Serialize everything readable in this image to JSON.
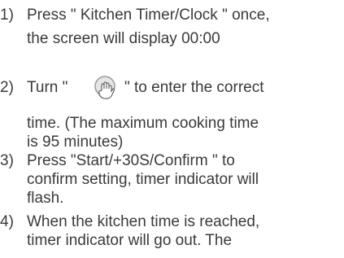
{
  "steps": [
    {
      "number": "1)",
      "lines": [
        "Press \" Kitchen Timer/Clock \" once,",
        "the screen will display 00:00"
      ]
    },
    {
      "number": "2)",
      "lines": [
        "Turn \"",
        "\" to enter the correct",
        "time. (The maximum cooking time",
        "is 95 minutes)"
      ]
    },
    {
      "number": "3)",
      "lines": [
        "Press \"Start/+30S/Confirm \" to",
        "confirm setting, timer indicator will",
        "flash."
      ]
    },
    {
      "number": "4)",
      "lines": [
        "When the kitchen time is reached,",
        "timer indicator will go out. The"
      ]
    }
  ],
  "icons": {
    "dial": "rotary-knob-icon"
  }
}
